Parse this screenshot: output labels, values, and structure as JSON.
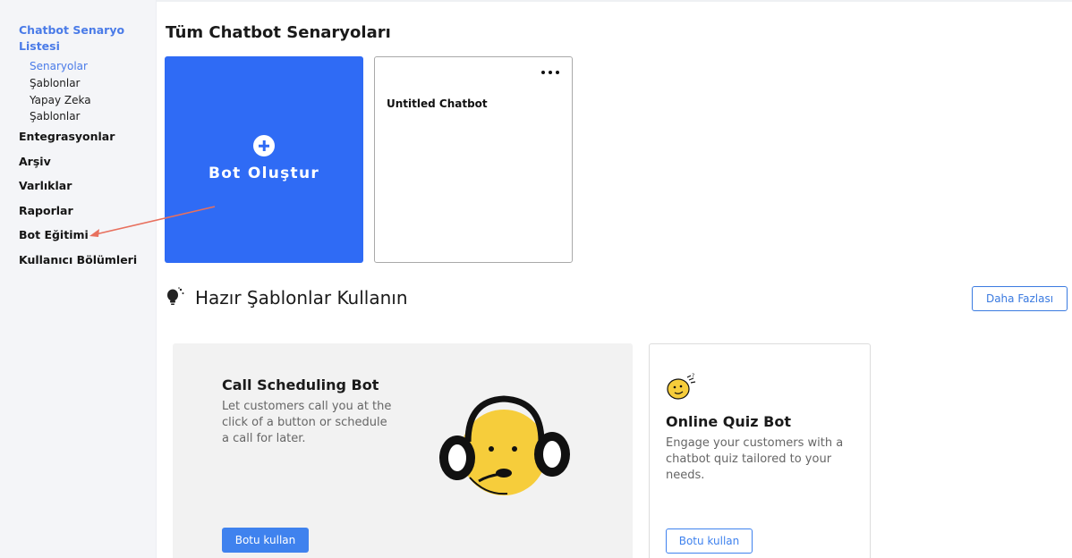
{
  "sidebar": {
    "header": "Chatbot Senaryo Listesi",
    "sub_items": [
      "Senaryolar",
      "Şablonlar",
      "Yapay Zeka",
      "Şablonlar"
    ],
    "items": [
      "Entegrasyonlar",
      "Arşiv",
      "Varlıklar",
      "Raporlar",
      "Bot Eğitimi",
      "Kullanıcı Bölümleri"
    ]
  },
  "main": {
    "title": "Tüm Chatbot Senaryoları",
    "create_label": "Bot Oluştur",
    "bots": [
      {
        "name": "Untitled Chatbot"
      }
    ]
  },
  "templates": {
    "title": "Hazır Şablonlar Kullanın",
    "more_label": "Daha Fazlası",
    "cards": [
      {
        "title": "Call Scheduling Bot",
        "description": "Let customers call you at the click of a button or schedule a call for later.",
        "button": "Botu kullan"
      },
      {
        "title": "Online Quiz Bot",
        "description": "Engage your customers with a chatbot quiz tailored to your needs.",
        "button": "Botu kullan"
      }
    ]
  },
  "colors": {
    "accent": "#2f6bf5",
    "sidebar_bg": "#f4f5f8",
    "arrow": "#e8705e"
  }
}
